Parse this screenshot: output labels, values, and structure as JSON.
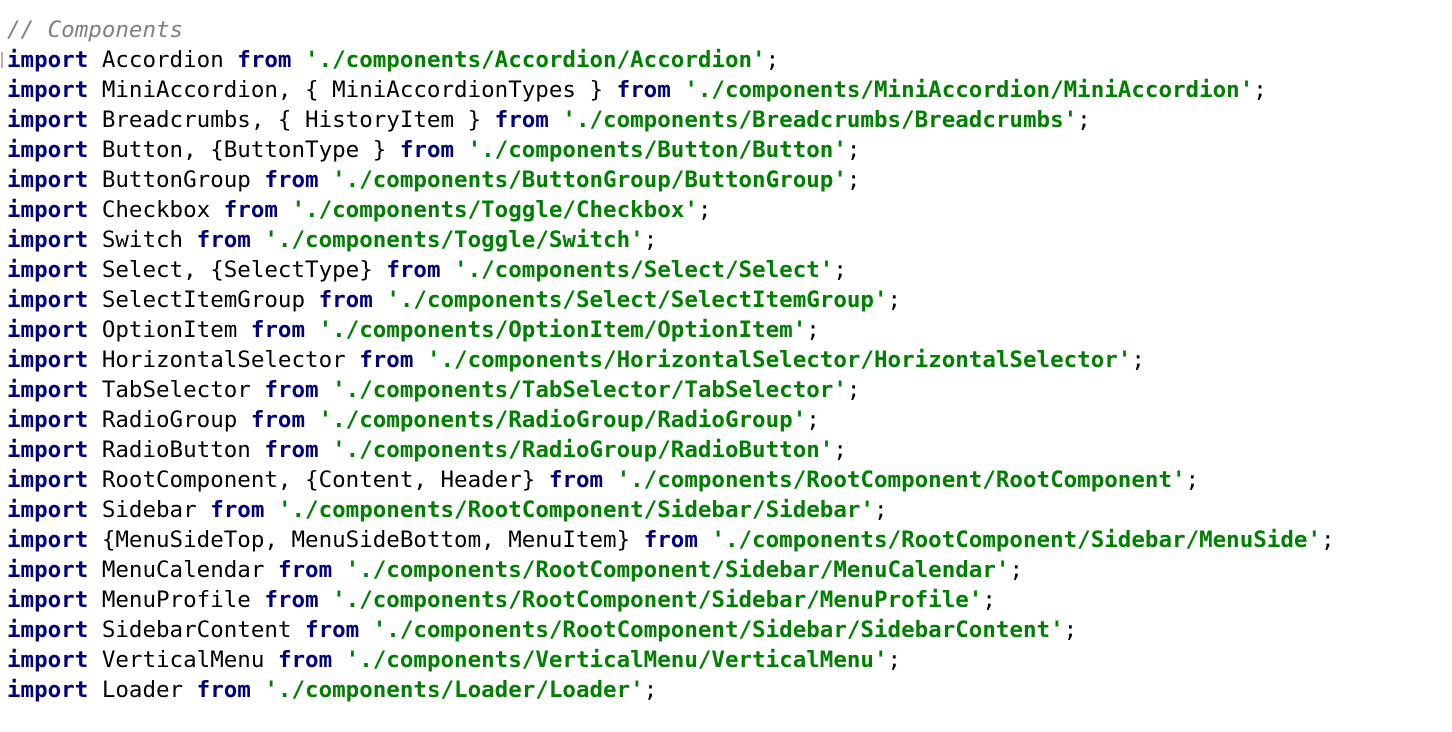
{
  "editor": {
    "comment": "// Components",
    "keyword_import": "import",
    "keyword_from": "from",
    "lines": [
      {
        "imports": "Accordion",
        "path": "'./components/Accordion/Accordion'"
      },
      {
        "imports": "MiniAccordion, { MiniAccordionTypes }",
        "path": "'./components/MiniAccordion/MiniAccordion'"
      },
      {
        "imports": "Breadcrumbs, { HistoryItem }",
        "path": "'./components/Breadcrumbs/Breadcrumbs'"
      },
      {
        "imports": "Button, {ButtonType }",
        "path": "'./components/Button/Button'"
      },
      {
        "imports": "ButtonGroup",
        "path": "'./components/ButtonGroup/ButtonGroup'"
      },
      {
        "imports": "Checkbox",
        "path": "'./components/Toggle/Checkbox'"
      },
      {
        "imports": "Switch",
        "path": "'./components/Toggle/Switch'"
      },
      {
        "imports": "Select, {SelectType}",
        "path": "'./components/Select/Select'"
      },
      {
        "imports": "SelectItemGroup",
        "path": "'./components/Select/SelectItemGroup'"
      },
      {
        "imports": "OptionItem",
        "path": "'./components/OptionItem/OptionItem'"
      },
      {
        "imports": "HorizontalSelector",
        "path": "'./components/HorizontalSelector/HorizontalSelector'"
      },
      {
        "imports": "TabSelector",
        "path": "'./components/TabSelector/TabSelector'"
      },
      {
        "imports": "RadioGroup",
        "path": "'./components/RadioGroup/RadioGroup'"
      },
      {
        "imports": "RadioButton",
        "path": "'./components/RadioGroup/RadioButton'"
      },
      {
        "imports": "RootComponent, {Content, Header}",
        "path": "'./components/RootComponent/RootComponent'"
      },
      {
        "imports": "Sidebar",
        "path": "'./components/RootComponent/Sidebar/Sidebar'"
      },
      {
        "imports": "{MenuSideTop, MenuSideBottom, MenuItem}",
        "path": "'./components/RootComponent/Sidebar/MenuSide'"
      },
      {
        "imports": "MenuCalendar",
        "path": "'./components/RootComponent/Sidebar/MenuCalendar'"
      },
      {
        "imports": "MenuProfile",
        "path": "'./components/RootComponent/Sidebar/MenuProfile'"
      },
      {
        "imports": "SidebarContent",
        "path": "'./components/RootComponent/Sidebar/SidebarContent'"
      },
      {
        "imports": "VerticalMenu",
        "path": "'./components/VerticalMenu/VerticalMenu'"
      },
      {
        "imports": "Loader",
        "path": "'./components/Loader/Loader'"
      }
    ],
    "colors": {
      "background": "#ffffff",
      "comment": "#808080",
      "keyword": "#000080",
      "string": "#008000",
      "identifier": "#000000"
    }
  }
}
